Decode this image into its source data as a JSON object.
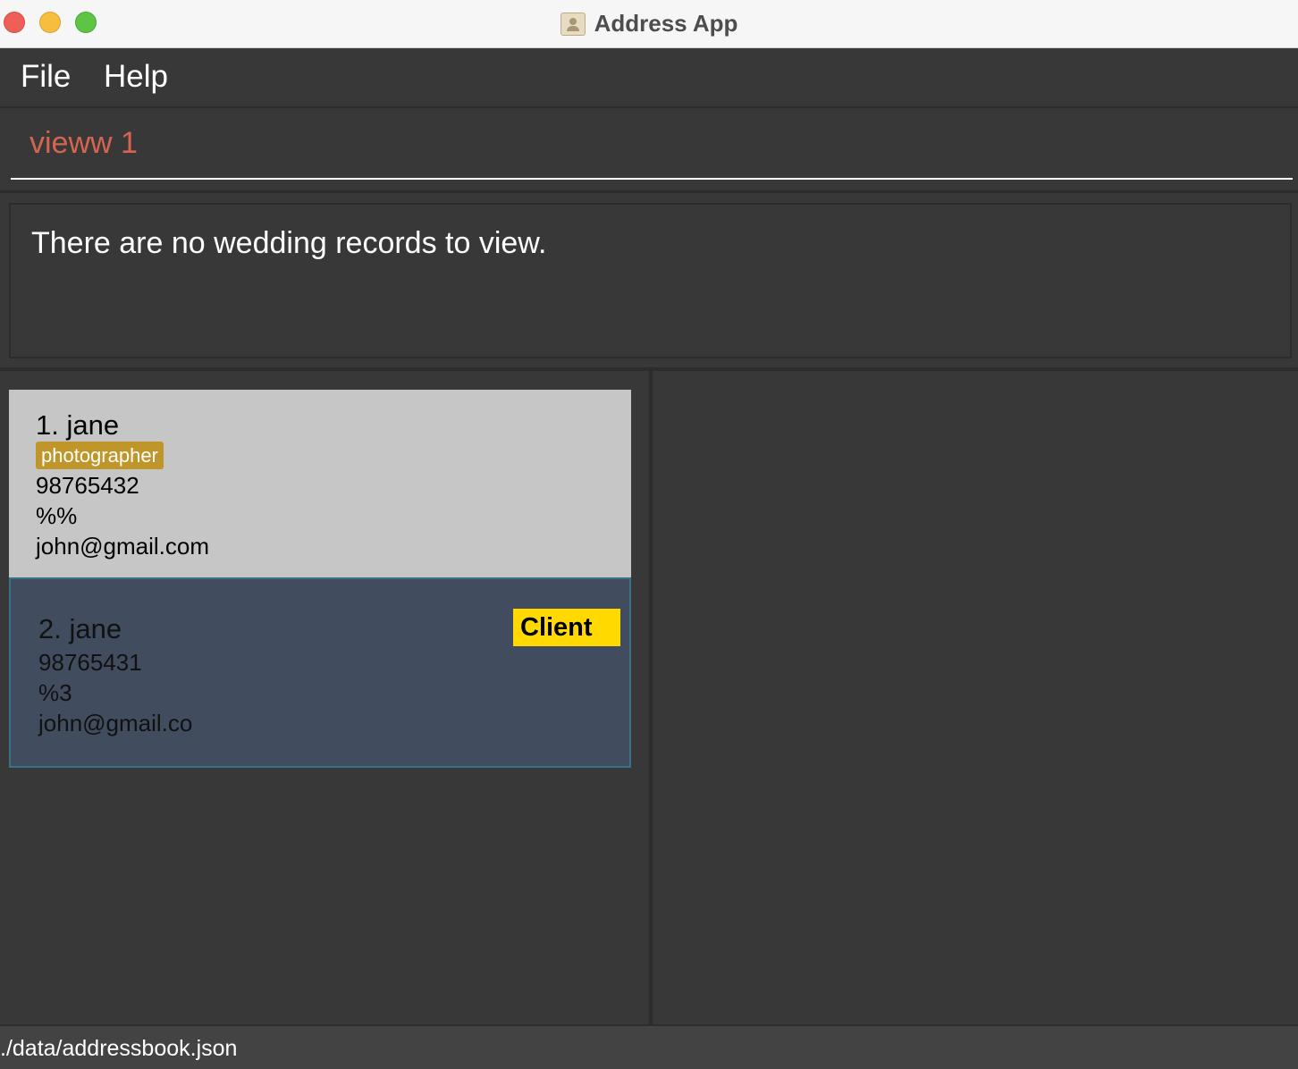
{
  "window": {
    "title": "Address App"
  },
  "menu": {
    "file": "File",
    "help": "Help"
  },
  "command": {
    "value": "vieww 1"
  },
  "result": {
    "message": "There are no wedding records to view."
  },
  "persons": [
    {
      "index_name": "1. jane",
      "tag": "photographer",
      "phone": "98765432",
      "address": "%%",
      "email": "john@gmail.com"
    },
    {
      "index_name": "2. jane",
      "badge": "Client",
      "phone": "98765431",
      "address": "%3",
      "email": "john@gmail.co"
    }
  ],
  "status": {
    "file_path": "./data/addressbook.json"
  },
  "colors": {
    "command_text": "#d6654f",
    "tag_bg": "#c0962a",
    "client_badge_bg": "#ffd900",
    "selected_card_bg": "#414c5e"
  }
}
